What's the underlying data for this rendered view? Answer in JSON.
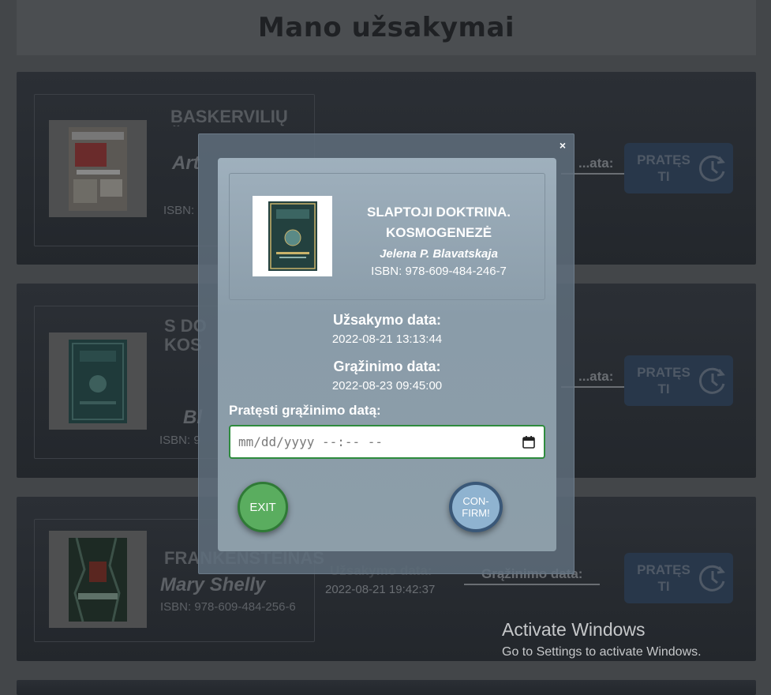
{
  "page": {
    "title": "Mano užsakymai"
  },
  "orders": [
    {
      "title": "BASKERVILIŲ ŠUO",
      "author": "Art",
      "isbn_prefix": "ISBN: ",
      "return_label": "...ata:",
      "extend_label": "PRATĘS TI"
    },
    {
      "title": "S DO KOS",
      "author": "Bl",
      "isbn_prefix": "ISBN: 9",
      "return_label": "...ata:",
      "extend_label": "PRATĘS TI"
    },
    {
      "title": "FRANKENSTEINAS",
      "author": "Mary Shelly",
      "isbn": "ISBN: 978-609-484-256-6",
      "order_date_label": "Užsakymo data:",
      "order_date": "2022-08-21 19:42:37",
      "return_label": "Grąžinimo data:",
      "extend_label": "PRATĘS TI"
    }
  ],
  "modal": {
    "close": "×",
    "book": {
      "title_line1": "SLAPTOJI DOKTRINA.",
      "title_line2": "KOSMOGENEZĖ",
      "author": "Jelena P. Blavatskaja",
      "isbn": "ISBN: 978-609-484-246-7"
    },
    "order_date_label": "Užsakymo data:",
    "order_date": "2022-08-21 13:13:44",
    "return_date_label": "Grąžinimo data:",
    "return_date": "2022-08-23 09:45:00",
    "extend_label": "Pratęsti grąžinimo datą:",
    "date_input_placeholder": "mm/dd/yyyy --:-- --",
    "exit_label": "EXIT",
    "confirm_label": "CON- FIRM!"
  },
  "windows_notice": {
    "title": "Activate Windows",
    "subtitle": "Go to Settings to activate Windows."
  },
  "colors": {
    "accent_green": "#5aad5f",
    "confirm_blue": "#8fb3d0",
    "extend_button": "#28374a"
  }
}
